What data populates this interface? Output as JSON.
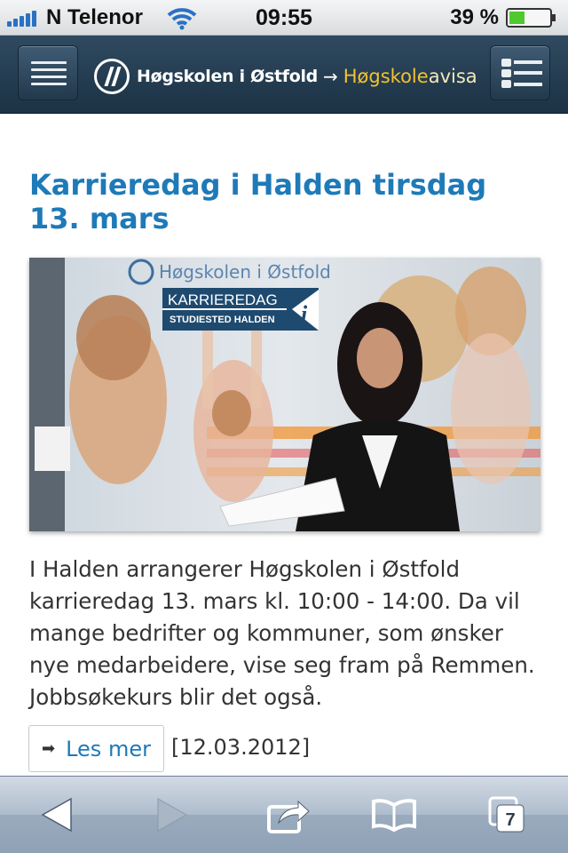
{
  "status_bar": {
    "carrier": "N Telenor",
    "time": "09:55",
    "battery_percent": "39 %",
    "battery_level": 0.39
  },
  "header": {
    "brand": "Høgskolen i Østfold",
    "arrow": "→",
    "section_part1": "Høgskole",
    "section_part2": "avisa",
    "colors": {
      "background": "#1c3245",
      "accent": "#f2c230"
    }
  },
  "article": {
    "title": "Karrieredag i Halden tirsdag 13. mars",
    "image": {
      "banner_brand": "Høgskolen i Østfold",
      "banner_title": "KARRIEREDAG",
      "banner_subtitle": "STUDIESTED HALDEN",
      "banner_icon": "i"
    },
    "body": "I Halden arrangerer Høgskolen i Østfold karrieredag 13. mars kl. 10:00 - 14:00. Da vil mange bedrifter og kommuner, som ønsker nye medarbeidere, vise seg fram på Remmen. Jobbsøkekurs blir det også.",
    "read_more_label": "Les mer",
    "date": "[12.03.2012]"
  },
  "toolbar": {
    "tab_count": "7",
    "icons": [
      "back-icon",
      "forward-icon",
      "share-icon",
      "bookmarks-icon",
      "tabs-icon"
    ]
  }
}
